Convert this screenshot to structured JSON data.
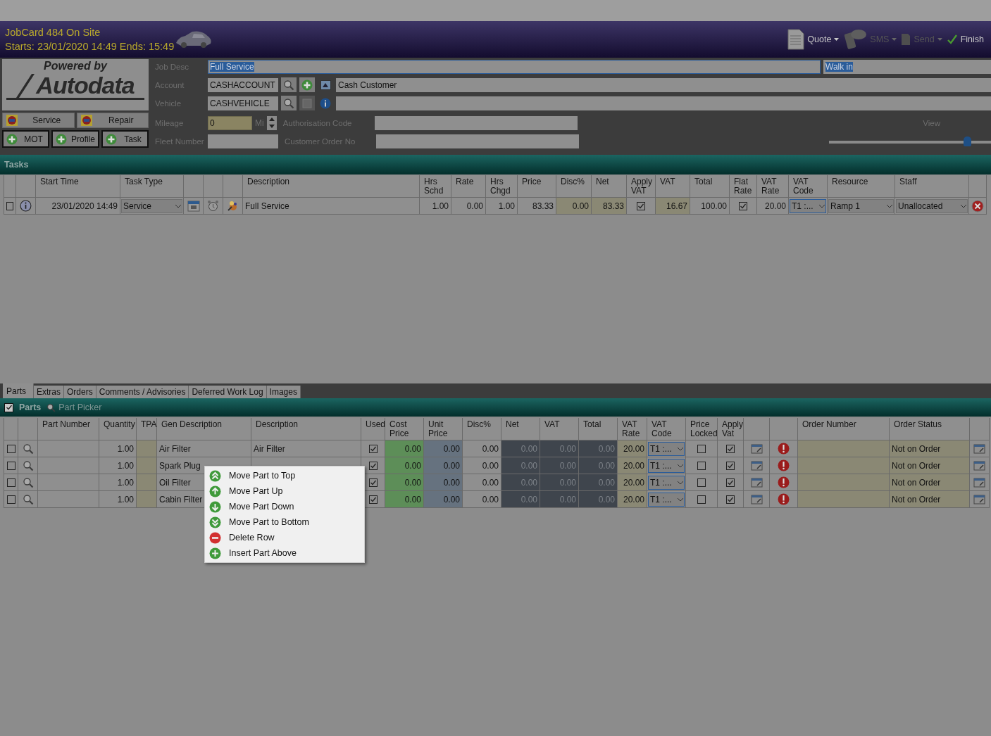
{
  "header": {
    "title": "JobCard 484 On Site",
    "times": "Starts: 23/01/2020 14:49 Ends: 15:49",
    "toolbar": [
      {
        "label": "Quote",
        "kind": "quote",
        "disabled": false,
        "dropdown": true
      },
      {
        "label": "SMS",
        "kind": "sms",
        "disabled": true,
        "dropdown": true
      },
      {
        "label": "Send",
        "kind": "send",
        "disabled": true,
        "dropdown": true
      },
      {
        "label": "Finish",
        "kind": "finish",
        "disabled": false,
        "dropdown": false
      }
    ]
  },
  "logo": {
    "tagline": "Powered by",
    "brand": "Autodata"
  },
  "quick_buttons": [
    {
      "label": "Service",
      "kind": "badge"
    },
    {
      "label": "Repair",
      "kind": "badge"
    },
    {
      "label": "MOT",
      "kind": "add"
    },
    {
      "label": "Profile",
      "kind": "add"
    },
    {
      "label": "Task",
      "kind": "add"
    }
  ],
  "form": {
    "job_desc": {
      "label": "Job Desc",
      "value": "Full Service",
      "extra": "Walk in"
    },
    "account": {
      "label": "Account",
      "value": "CASHACCOUNT",
      "name": "Cash Customer"
    },
    "vehicle": {
      "label": "Vehicle",
      "value": "CASHVEHICLE"
    },
    "mileage": {
      "label": "Mileage",
      "value": "0",
      "unit": "Mi"
    },
    "authorisation_code": {
      "label": "Authorisation Code"
    },
    "fleet_number": {
      "label": "Fleet Number"
    },
    "customer_order_no": {
      "label": "Customer Order No"
    },
    "view": {
      "label": "View",
      "level": 0.85
    }
  },
  "tasks": {
    "title": "Tasks",
    "columns": [
      "Start Time",
      "Task Type",
      "Description",
      "Hrs\nSchd",
      "Rate",
      "Hrs\nChgd",
      "Price",
      "Disc%",
      "Net",
      "Apply\nVAT",
      "VAT",
      "Total",
      "Flat\nRate",
      "VAT\nRate",
      "VAT\nCode",
      "Resource",
      "Staff"
    ],
    "rows": [
      {
        "checked": false,
        "start_time": "23/01/2020 14:49",
        "task_type": "Service",
        "description": "Full Service",
        "hrs_schd": "1.00",
        "rate": "0.00",
        "hrs_chgd": "1.00",
        "price": "83.33",
        "disc": "0.00",
        "net": "83.33",
        "apply_vat": true,
        "vat": "16.67",
        "total": "100.00",
        "flat_rate": true,
        "vat_rate": "20.00",
        "vat_code": "T1 :...",
        "resource": "Ramp 1",
        "staff": "Unallocated"
      }
    ]
  },
  "tabs": [
    {
      "label": "Parts",
      "selected": true
    },
    {
      "label": "Extras",
      "selected": false
    },
    {
      "label": "Orders",
      "selected": false
    },
    {
      "label": "Comments / Advisories",
      "selected": false
    },
    {
      "label": "Deferred Work Log",
      "selected": false
    },
    {
      "label": "Images",
      "selected": false
    }
  ],
  "parts": {
    "title": "Parts",
    "picker": "Part Picker",
    "all_checked": true,
    "columns": [
      "Part Number",
      "Quantity",
      "TPA",
      "Gen Description",
      "Description",
      "Used",
      "Cost\nPrice",
      "Unit\nPrice",
      "Disc%",
      "Net",
      "VAT",
      "Total",
      "VAT\nRate",
      "VAT\nCode",
      "Price\nLocked",
      "Apply\nVat",
      "Order Number",
      "Order Status"
    ],
    "rows": [
      {
        "checked": false,
        "quantity": "1.00",
        "gen_description": "Air Filter",
        "description": "Air Filter",
        "used": true,
        "cost_price": "0.00",
        "unit_price": "0.00",
        "disc": "0.00",
        "net": "0.00",
        "vat": "0.00",
        "total": "0.00",
        "vat_rate": "20.00",
        "vat_code": "T1 :...",
        "price_locked": false,
        "apply_vat": true,
        "order_status": "Not on Order"
      },
      {
        "checked": false,
        "quantity": "1.00",
        "gen_description": "Spark Plug",
        "used": true,
        "cost_price": "0.00",
        "unit_price": "0.00",
        "disc": "0.00",
        "net": "0.00",
        "vat": "0.00",
        "total": "0.00",
        "vat_rate": "20.00",
        "vat_code": "T1 :...",
        "price_locked": false,
        "apply_vat": true,
        "order_status": "Not on Order"
      },
      {
        "checked": false,
        "quantity": "1.00",
        "gen_description": "Oil Filter",
        "used": true,
        "cost_price": "0.00",
        "unit_price": "0.00",
        "disc": "0.00",
        "net": "0.00",
        "vat": "0.00",
        "total": "0.00",
        "vat_rate": "20.00",
        "vat_code": "T1 :...",
        "price_locked": false,
        "apply_vat": true,
        "order_status": "Not on Order"
      },
      {
        "checked": false,
        "quantity": "1.00",
        "gen_description": "Cabin Filter",
        "used": true,
        "cost_price": "0.00",
        "unit_price": "0.00",
        "disc": "0.00",
        "net": "0.00",
        "vat": "0.00",
        "total": "0.00",
        "vat_rate": "20.00",
        "vat_code": "T1 :...",
        "price_locked": false,
        "apply_vat": true,
        "order_status": "Not on Order"
      }
    ]
  },
  "context_menu": {
    "items": [
      {
        "label": "Move Part to Top",
        "kind": "top"
      },
      {
        "label": "Move Part Up",
        "kind": "up"
      },
      {
        "label": "Move Part Down",
        "kind": "down"
      },
      {
        "label": "Move Part to Bottom",
        "kind": "bottom"
      },
      {
        "label": "Delete Row",
        "kind": "delete"
      },
      {
        "label": "Insert Part Above",
        "kind": "add"
      }
    ]
  }
}
